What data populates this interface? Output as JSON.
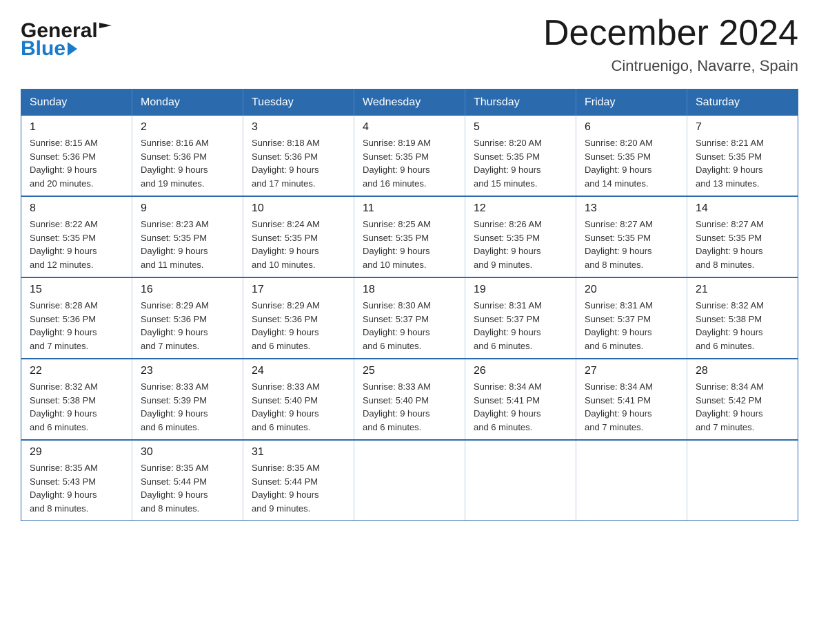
{
  "header": {
    "logo_general": "General",
    "logo_blue": "Blue",
    "month_title": "December 2024",
    "location": "Cintruenigo, Navarre, Spain"
  },
  "days_of_week": [
    "Sunday",
    "Monday",
    "Tuesday",
    "Wednesday",
    "Thursday",
    "Friday",
    "Saturday"
  ],
  "weeks": [
    [
      {
        "day": "1",
        "sunrise": "8:15 AM",
        "sunset": "5:36 PM",
        "daylight": "9 hours and 20 minutes."
      },
      {
        "day": "2",
        "sunrise": "8:16 AM",
        "sunset": "5:36 PM",
        "daylight": "9 hours and 19 minutes."
      },
      {
        "day": "3",
        "sunrise": "8:18 AM",
        "sunset": "5:36 PM",
        "daylight": "9 hours and 17 minutes."
      },
      {
        "day": "4",
        "sunrise": "8:19 AM",
        "sunset": "5:35 PM",
        "daylight": "9 hours and 16 minutes."
      },
      {
        "day": "5",
        "sunrise": "8:20 AM",
        "sunset": "5:35 PM",
        "daylight": "9 hours and 15 minutes."
      },
      {
        "day": "6",
        "sunrise": "8:20 AM",
        "sunset": "5:35 PM",
        "daylight": "9 hours and 14 minutes."
      },
      {
        "day": "7",
        "sunrise": "8:21 AM",
        "sunset": "5:35 PM",
        "daylight": "9 hours and 13 minutes."
      }
    ],
    [
      {
        "day": "8",
        "sunrise": "8:22 AM",
        "sunset": "5:35 PM",
        "daylight": "9 hours and 12 minutes."
      },
      {
        "day": "9",
        "sunrise": "8:23 AM",
        "sunset": "5:35 PM",
        "daylight": "9 hours and 11 minutes."
      },
      {
        "day": "10",
        "sunrise": "8:24 AM",
        "sunset": "5:35 PM",
        "daylight": "9 hours and 10 minutes."
      },
      {
        "day": "11",
        "sunrise": "8:25 AM",
        "sunset": "5:35 PM",
        "daylight": "9 hours and 10 minutes."
      },
      {
        "day": "12",
        "sunrise": "8:26 AM",
        "sunset": "5:35 PM",
        "daylight": "9 hours and 9 minutes."
      },
      {
        "day": "13",
        "sunrise": "8:27 AM",
        "sunset": "5:35 PM",
        "daylight": "9 hours and 8 minutes."
      },
      {
        "day": "14",
        "sunrise": "8:27 AM",
        "sunset": "5:35 PM",
        "daylight": "9 hours and 8 minutes."
      }
    ],
    [
      {
        "day": "15",
        "sunrise": "8:28 AM",
        "sunset": "5:36 PM",
        "daylight": "9 hours and 7 minutes."
      },
      {
        "day": "16",
        "sunrise": "8:29 AM",
        "sunset": "5:36 PM",
        "daylight": "9 hours and 7 minutes."
      },
      {
        "day": "17",
        "sunrise": "8:29 AM",
        "sunset": "5:36 PM",
        "daylight": "9 hours and 6 minutes."
      },
      {
        "day": "18",
        "sunrise": "8:30 AM",
        "sunset": "5:37 PM",
        "daylight": "9 hours and 6 minutes."
      },
      {
        "day": "19",
        "sunrise": "8:31 AM",
        "sunset": "5:37 PM",
        "daylight": "9 hours and 6 minutes."
      },
      {
        "day": "20",
        "sunrise": "8:31 AM",
        "sunset": "5:37 PM",
        "daylight": "9 hours and 6 minutes."
      },
      {
        "day": "21",
        "sunrise": "8:32 AM",
        "sunset": "5:38 PM",
        "daylight": "9 hours and 6 minutes."
      }
    ],
    [
      {
        "day": "22",
        "sunrise": "8:32 AM",
        "sunset": "5:38 PM",
        "daylight": "9 hours and 6 minutes."
      },
      {
        "day": "23",
        "sunrise": "8:33 AM",
        "sunset": "5:39 PM",
        "daylight": "9 hours and 6 minutes."
      },
      {
        "day": "24",
        "sunrise": "8:33 AM",
        "sunset": "5:40 PM",
        "daylight": "9 hours and 6 minutes."
      },
      {
        "day": "25",
        "sunrise": "8:33 AM",
        "sunset": "5:40 PM",
        "daylight": "9 hours and 6 minutes."
      },
      {
        "day": "26",
        "sunrise": "8:34 AM",
        "sunset": "5:41 PM",
        "daylight": "9 hours and 6 minutes."
      },
      {
        "day": "27",
        "sunrise": "8:34 AM",
        "sunset": "5:41 PM",
        "daylight": "9 hours and 7 minutes."
      },
      {
        "day": "28",
        "sunrise": "8:34 AM",
        "sunset": "5:42 PM",
        "daylight": "9 hours and 7 minutes."
      }
    ],
    [
      {
        "day": "29",
        "sunrise": "8:35 AM",
        "sunset": "5:43 PM",
        "daylight": "9 hours and 8 minutes."
      },
      {
        "day": "30",
        "sunrise": "8:35 AM",
        "sunset": "5:44 PM",
        "daylight": "9 hours and 8 minutes."
      },
      {
        "day": "31",
        "sunrise": "8:35 AM",
        "sunset": "5:44 PM",
        "daylight": "9 hours and 9 minutes."
      },
      null,
      null,
      null,
      null
    ]
  ],
  "labels": {
    "sunrise": "Sunrise:",
    "sunset": "Sunset:",
    "daylight": "Daylight:"
  }
}
